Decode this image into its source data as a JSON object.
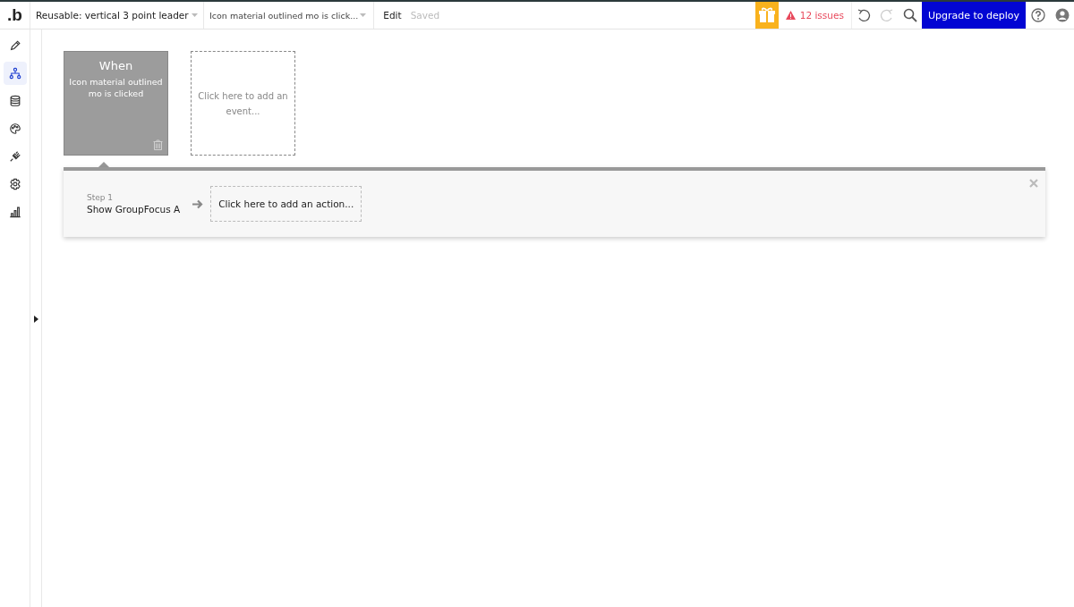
{
  "topbar": {
    "logo": ".b",
    "page_dropdown": "Reusable: vertical 3 point leader",
    "event_dropdown": "Icon material outlined mo is click...",
    "edit": "Edit",
    "save_status": "Saved",
    "issues": "12 issues",
    "redo_disabled": true,
    "upgrade_button": "Upgrade to deploy"
  },
  "sidebar": {
    "items": [
      {
        "selected": false
      },
      {
        "selected": true
      },
      {
        "selected": false
      },
      {
        "selected": false
      },
      {
        "selected": false
      },
      {
        "selected": false
      },
      {
        "selected": false
      }
    ]
  },
  "events": [
    {
      "title": "When",
      "text": "Icon material outlined mo is clicked",
      "selected": true
    }
  ],
  "add_event": "Click here to add an event...",
  "action_panel": {
    "steps": [
      {
        "label": "Step 1",
        "text": "Show GroupFocus A"
      }
    ],
    "add_action": "Click here to add an action..."
  }
}
